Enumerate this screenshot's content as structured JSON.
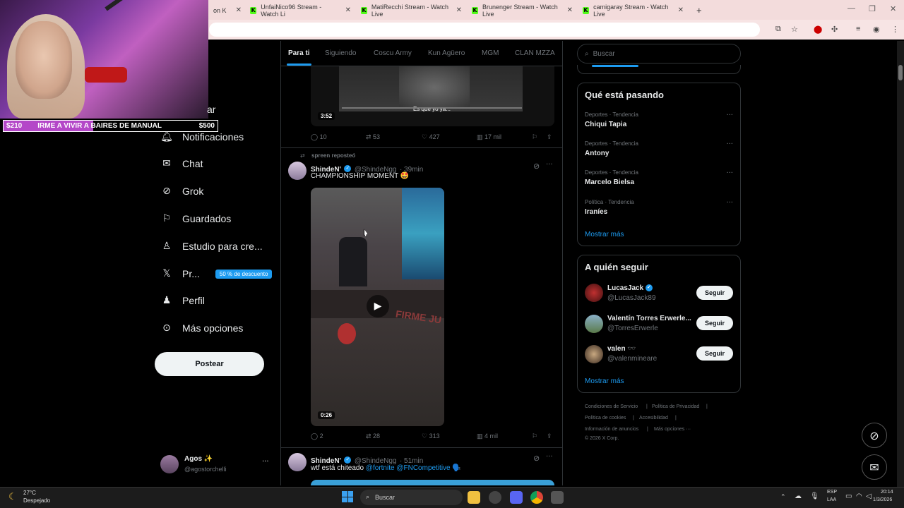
{
  "browser": {
    "tabs": [
      {
        "label": "on K",
        "icon": "kick-icon"
      },
      {
        "label": "UnfaiNico96 Stream - Watch Li",
        "icon": "kick-icon"
      },
      {
        "label": "MatiRecchi Stream - Watch Live",
        "icon": "kick-icon"
      },
      {
        "label": "Brunenger Stream - Watch Live",
        "icon": "kick-icon"
      },
      {
        "label": "camigaray Stream - Watch Live",
        "icon": "kick-icon"
      }
    ],
    "new_tab": "+"
  },
  "overlay": {
    "banner": {
      "left_amount": "$210",
      "text": "IRME A VIVIR A BAIRES DE MANUAL",
      "right_amount": "$500",
      "progress": 0.42
    },
    "partial_nav_text": "ar"
  },
  "nav": {
    "items": [
      {
        "label": "Notificaciones",
        "icon": "bell-icon"
      },
      {
        "label": "Chat",
        "icon": "mail-icon"
      },
      {
        "label": "Grok",
        "icon": "grok-icon"
      },
      {
        "label": "Guardados",
        "icon": "bookmark-icon"
      },
      {
        "label": "Estudio para cre...",
        "icon": "flask-icon"
      },
      {
        "label": "Pr...",
        "icon": "x-logo-icon"
      },
      {
        "label": "Perfil",
        "icon": "person-icon"
      },
      {
        "label": "Más opciones",
        "icon": "more-circle-icon"
      }
    ],
    "premium_badge": "50 % de descuento",
    "post_button": "Postear",
    "profile": {
      "name": "Agos ✨",
      "handle": "@agostorchelli"
    }
  },
  "feed": {
    "tabs": [
      "Para ti",
      "Siguiendo",
      "Coscu Army",
      "Kun Agüero",
      "MGM",
      "CLAN MZZA"
    ],
    "active_tab": "Para ti",
    "post1": {
      "video_caption": "Es que yo ya...",
      "duration": "3:52",
      "replies": "10",
      "reposts": "53",
      "likes": "427",
      "views": "17 mil"
    },
    "post2": {
      "reposted_by": "spreen reposteó",
      "name": "ShindeN'",
      "handle": "@ShindeNgg",
      "time": "· 39min",
      "text": "CHAMPIONSHIP MOMENT 🤩",
      "video_sign": "FIRME JU",
      "duration": "0:26",
      "replies": "2",
      "reposts": "28",
      "likes": "313",
      "views": "4 mil"
    },
    "post3": {
      "name": "ShindeN'",
      "handle": "@ShindeNgg",
      "time": "· 51min",
      "text_prefix": "wtf está chiteado ",
      "mention1": "@fortnite",
      "mention2": "@FNCompetitive",
      "emoji": "🗣️"
    }
  },
  "sidebar": {
    "search_placeholder": "Buscar",
    "trends_title": "Qué está pasando",
    "trends": [
      {
        "category": "Deportes · Tendencia",
        "name": "Chiqui Tapia"
      },
      {
        "category": "Deportes · Tendencia",
        "name": "Antony"
      },
      {
        "category": "Deportes · Tendencia",
        "name": "Marcelo Bielsa"
      },
      {
        "category": "Política · Tendencia",
        "name": "Iraníes"
      }
    ],
    "show_more": "Mostrar más",
    "follow_title": "A quién seguir",
    "follow": [
      {
        "name": "LucasJack",
        "handle": "@LucasJack89",
        "button": "Seguir",
        "verified": true
      },
      {
        "name": "Valentín Torres Erwerle...",
        "handle": "@TorresErwerle",
        "button": "Seguir",
        "verified": false
      },
      {
        "name": "valen 🕶️",
        "handle": "@valenmineare",
        "button": "Seguir",
        "verified": false
      }
    ],
    "follow_show_more": "Mostrar más",
    "footer": {
      "line1a": "Condiciones de Servicio",
      "line1b": "Política de Privacidad",
      "line2a": "Política de cookies",
      "line2b": "Accesibilidad",
      "line3a": "Información de anuncios",
      "line3b": "Más opciones ···",
      "copyright": "© 2026 X Corp."
    }
  },
  "taskbar": {
    "weather_temp": "27°C",
    "weather_desc": "Despejado",
    "search_placeholder": "Buscar",
    "lang1": "ESP",
    "lang2": "LAA",
    "time": "20:14",
    "date": "1/3/2026"
  },
  "colors": {
    "accent": "#1d9bf0",
    "kick": "#53fc18",
    "banner_fill": "#b447c8"
  }
}
